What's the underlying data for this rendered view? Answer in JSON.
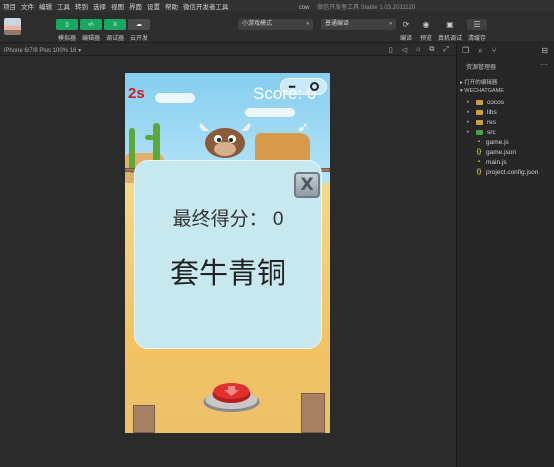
{
  "menubar": {
    "items": [
      "项目",
      "文件",
      "编辑",
      "工具",
      "转到",
      "选择",
      "视图",
      "界面",
      "设置",
      "帮助",
      "微信开发者工具"
    ],
    "project_name": "cow",
    "app_title": "微信开发者工具 Stable 1.03.2011120"
  },
  "toolbar": {
    "simulator_label": "模拟器",
    "editor_label": "编辑器",
    "debugger_label": "调试器",
    "cloud_label": "云开发",
    "mode_select": "小游戏模式",
    "compile_select": "普通编译",
    "compile_label": "编译",
    "preview_label": "预览",
    "remote_debug_label": "真机调试",
    "clear_cache_label": "清缓存"
  },
  "simulator": {
    "device": "iPhone 6/7/8 Plus 100% 16"
  },
  "game": {
    "timer": "2s",
    "score": "Score: 0",
    "capsule_dots": "•••",
    "final_score": "最终得分：  0",
    "rank_title": "套牛青铜",
    "close_symbol": "X"
  },
  "explorer": {
    "title": "资源管理器",
    "more": "···",
    "open_editors": "打开的编辑器",
    "project_root": "WECHATGAME",
    "tree": [
      {
        "name": "cocos",
        "kind": "folder",
        "color": "#c8a040"
      },
      {
        "name": "libs",
        "kind": "folder",
        "color": "#c8a040"
      },
      {
        "name": "res",
        "kind": "folder",
        "color": "#c8a040"
      },
      {
        "name": "src",
        "kind": "folder",
        "color": "#47a047"
      },
      {
        "name": "game.js",
        "kind": "js",
        "color": "#d6c34a"
      },
      {
        "name": "game.json",
        "kind": "json",
        "color": "#d6c34a"
      },
      {
        "name": "main.js",
        "kind": "js",
        "color": "#d6c34a"
      },
      {
        "name": "project.config.json",
        "kind": "json",
        "color": "#d6c34a"
      }
    ]
  },
  "colors": {
    "accent_green": "#18a862",
    "timer_red": "#c82020",
    "dialog_bg": "#c8e8f0"
  }
}
